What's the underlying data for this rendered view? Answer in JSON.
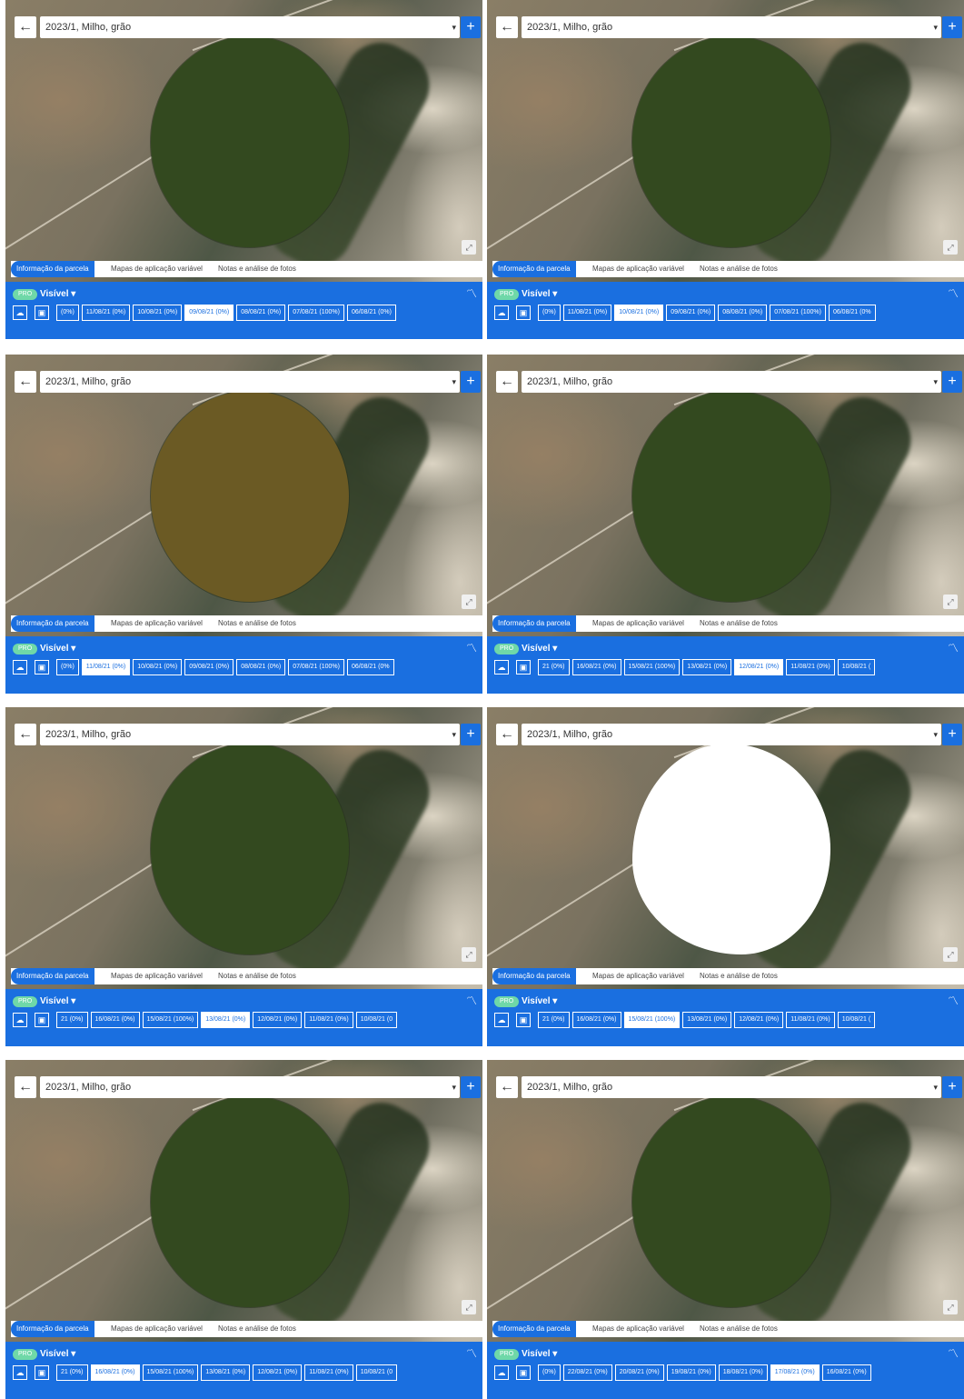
{
  "topbar": {
    "select_value": "2023/1, Milho, grão",
    "back_icon": "arrow-left-icon",
    "add_icon": "plus-icon"
  },
  "tabs": {
    "info": "Informação da parcela",
    "maps": "Mapas de aplicação variável",
    "notes": "Notas e análise de fotos"
  },
  "layer": {
    "pro": "PRO",
    "visible": "Visível"
  },
  "colors": {
    "accent": "#1a6fe0",
    "pro": "#6fd8a8"
  },
  "panels": [
    {
      "field_style": "green",
      "dates": [
        "(0%)",
        "11/08/21 (0%)",
        "10/08/21 (0%)",
        "09/08/21 (0%)",
        "08/08/21 (0%)",
        "07/08/21 (100%)",
        "06/08/21 (0%)"
      ],
      "selected": 3
    },
    {
      "field_style": "green",
      "dates": [
        "(0%)",
        "11/08/21 (0%)",
        "10/08/21 (0%)",
        "09/08/21 (0%)",
        "08/08/21 (0%)",
        "07/08/21 (100%)",
        "06/08/21 (0%"
      ],
      "selected": 2
    },
    {
      "field_style": "brown",
      "dates": [
        "(0%)",
        "11/08/21 (0%)",
        "10/08/21 (0%)",
        "09/08/21 (0%)",
        "08/08/21 (0%)",
        "07/08/21 (100%)",
        "06/08/21 (0%"
      ],
      "selected": 1
    },
    {
      "field_style": "green",
      "dates": [
        "21 (0%)",
        "16/08/21 (0%)",
        "15/08/21 (100%)",
        "13/08/21 (0%)",
        "12/08/21 (0%)",
        "11/08/21 (0%)",
        "10/08/21 ("
      ],
      "selected": 4
    },
    {
      "field_style": "green",
      "dates": [
        "21 (0%)",
        "16/08/21 (0%)",
        "15/08/21 (100%)",
        "13/08/21 (0%)",
        "12/08/21 (0%)",
        "11/08/21 (0%)",
        "10/08/21 (0"
      ],
      "selected": 3
    },
    {
      "field_style": "white",
      "dates": [
        "21 (0%)",
        "16/08/21 (0%)",
        "15/08/21 (100%)",
        "13/08/21 (0%)",
        "12/08/21 (0%)",
        "11/08/21 (0%)",
        "10/08/21 ("
      ],
      "selected": 2
    },
    {
      "field_style": "green",
      "dates": [
        "21 (0%)",
        "16/08/21 (0%)",
        "15/08/21 (100%)",
        "13/08/21 (0%)",
        "12/08/21 (0%)",
        "11/08/21 (0%)",
        "10/08/21 (0"
      ],
      "selected": 1
    },
    {
      "field_style": "green",
      "dates": [
        "(0%)",
        "22/08/21 (0%)",
        "20/08/21 (0%)",
        "19/08/21 (0%)",
        "18/08/21 (0%)",
        "17/08/21 (0%)",
        "16/08/21 (0%)"
      ],
      "selected": 5
    }
  ]
}
